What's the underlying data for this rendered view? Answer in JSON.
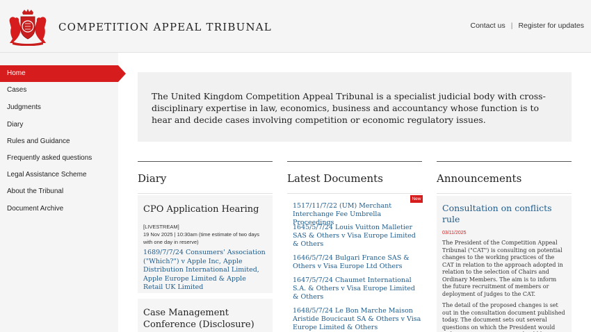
{
  "header": {
    "site_title": "COMPETITION APPEAL TRIBUNAL",
    "contact_link": "Contact us",
    "separator": "|",
    "register_link": "Register for updates"
  },
  "sidebar": {
    "items": [
      {
        "label": "Home",
        "active": true
      },
      {
        "label": "Cases"
      },
      {
        "label": "Judgments"
      },
      {
        "label": "Diary"
      },
      {
        "label": "Rules and Guidance"
      },
      {
        "label": "Frequently asked questions"
      },
      {
        "label": "Legal Assistance Scheme"
      },
      {
        "label": "About the Tribunal"
      },
      {
        "label": "Document Archive"
      }
    ]
  },
  "intro": {
    "text": "The United Kingdom Competition Appeal Tribunal is a specialist judicial body with cross-disciplinary expertise in law, economics, business and accountancy whose function is to hear and decide cases involving competition or economic regulatory issues."
  },
  "diary": {
    "title": "Diary",
    "cards": [
      {
        "title": "CPO Application Hearing",
        "tag": "[LIVESTREAM]",
        "datetime": "19 Nov 2025 | 10:30am (time estimate of two days with one day in reserve)",
        "case": "1689/7/7/24 Consumers' Association (\"Which?\") v Apple Inc, Apple Distribution International Limited, Apple Europe Limited & Apple Retail UK Limited"
      },
      {
        "title": "Case Management Conference (Disclosure)"
      }
    ]
  },
  "documents": {
    "title": "Latest Documents",
    "new_badge": "New",
    "items": [
      "1517/11/7/22 (UM) Merchant Interchange Fee Umbrella Proceedings",
      "1645/5/7/24 Louis Vuitton Malletier SAS & Others v Visa Europe Limited & Others",
      "1646/5/7/24 Bulgari France SAS & Others v Visa Europe Ltd Others",
      "1647/5/7/24 Chaumet International S.A. & Others v Visa Europe Limited & Others",
      "1648/5/7/24 Le Bon Marche Maison Aristide Boucicaut SA & Others v Visa Europe Limited & Others"
    ]
  },
  "announcements": {
    "title": "Announcements",
    "item": {
      "title": "Consultation on conflicts rule",
      "date": "03/11/2025",
      "para1": "The President of the Competition Appeal Tribunal (\"CAT\") is consulting on potential changes to the working practices of the CAT in relation to the approach adopted in relation to the selection of Chairs and Ordinary Members. The aim is to inform the future recruitment of members or deployment of judges to the CAT.",
      "para2": "The detail of the proposed changes is set out in the consultation document published today. The document sets out several questions on which the President would welcome views. Responses should be sent to"
    }
  },
  "colors": {
    "accent_red": "#d61c1c",
    "link_blue": "#1d5b8c"
  }
}
